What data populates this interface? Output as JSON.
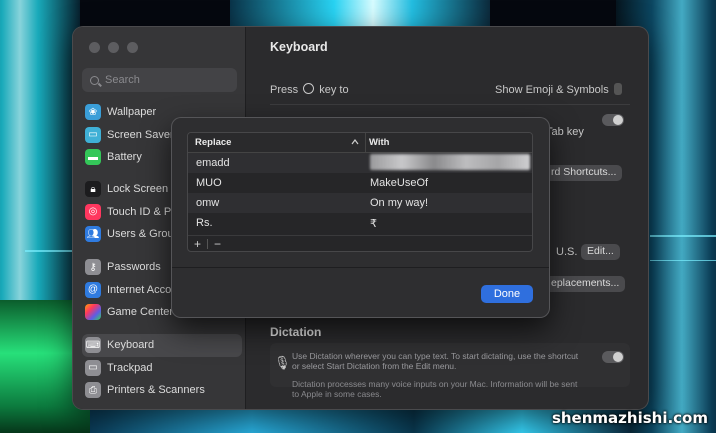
{
  "sidebar": {
    "search_placeholder": "Search",
    "group1": [
      {
        "label": "Wallpaper",
        "icon": "wallpaper-icon",
        "color": "#3a9ed8"
      },
      {
        "label": "Screen Saver",
        "icon": "screen-saver-icon",
        "color": "#3fb0d6"
      },
      {
        "label": "Battery",
        "icon": "battery-icon",
        "color": "#34c759"
      }
    ],
    "group2": [
      {
        "label": "Lock Screen",
        "icon": "lock-icon",
        "color": "#1c1c1e"
      },
      {
        "label": "Touch ID & Password",
        "icon": "fingerprint-icon",
        "color": "#ff375f"
      },
      {
        "label": "Users & Groups",
        "icon": "users-icon",
        "color": "#2f7be0"
      }
    ],
    "group3": [
      {
        "label": "Passwords",
        "icon": "key-icon",
        "color": "#8e8e93"
      },
      {
        "label": "Internet Accounts",
        "icon": "at-icon",
        "color": "#2f7be0"
      },
      {
        "label": "Game Center",
        "icon": "game-center-icon",
        "color": "#ff9f0a"
      }
    ],
    "group4": [
      {
        "label": "Keyboard",
        "icon": "keyboard-icon",
        "color": "#8e8e93",
        "active": true
      },
      {
        "label": "Trackpad",
        "icon": "trackpad-icon",
        "color": "#8e8e93"
      },
      {
        "label": "Printers & Scanners",
        "icon": "printer-icon",
        "color": "#8e8e93"
      }
    ]
  },
  "content": {
    "title": "Keyboard",
    "press_key_label": "Press",
    "press_key_suffix": "key to",
    "emoji_select_value": "Show Emoji & Symbols",
    "tab_key_text": "Tab key",
    "shortcuts_button": "rd Shortcuts...",
    "input_sources_value": "U.S.",
    "edit_button": "Edit...",
    "replacements_button": "eplacements...",
    "dictation_title": "Dictation",
    "dictation_desc1": "Use Dictation wherever you can type text. To start dictating, use the shortcut",
    "dictation_desc2": "or select Start Dictation from the Edit menu.",
    "dictation_note1": "Dictation processes many voice inputs on your Mac. Information will be sent",
    "dictation_note2": "to Apple in some cases."
  },
  "sheet": {
    "col_replace": "Replace",
    "col_with": "With",
    "rows": [
      {
        "replace": "emadd",
        "with": ""
      },
      {
        "replace": "MUO",
        "with": "MakeUseOf"
      },
      {
        "replace": "omw",
        "with": "On my way!"
      },
      {
        "replace": "Rs.",
        "with": "₹"
      }
    ],
    "add_label": "+",
    "remove_label": "−",
    "done_label": "Done"
  },
  "watermark": "shenmazhishi.com"
}
